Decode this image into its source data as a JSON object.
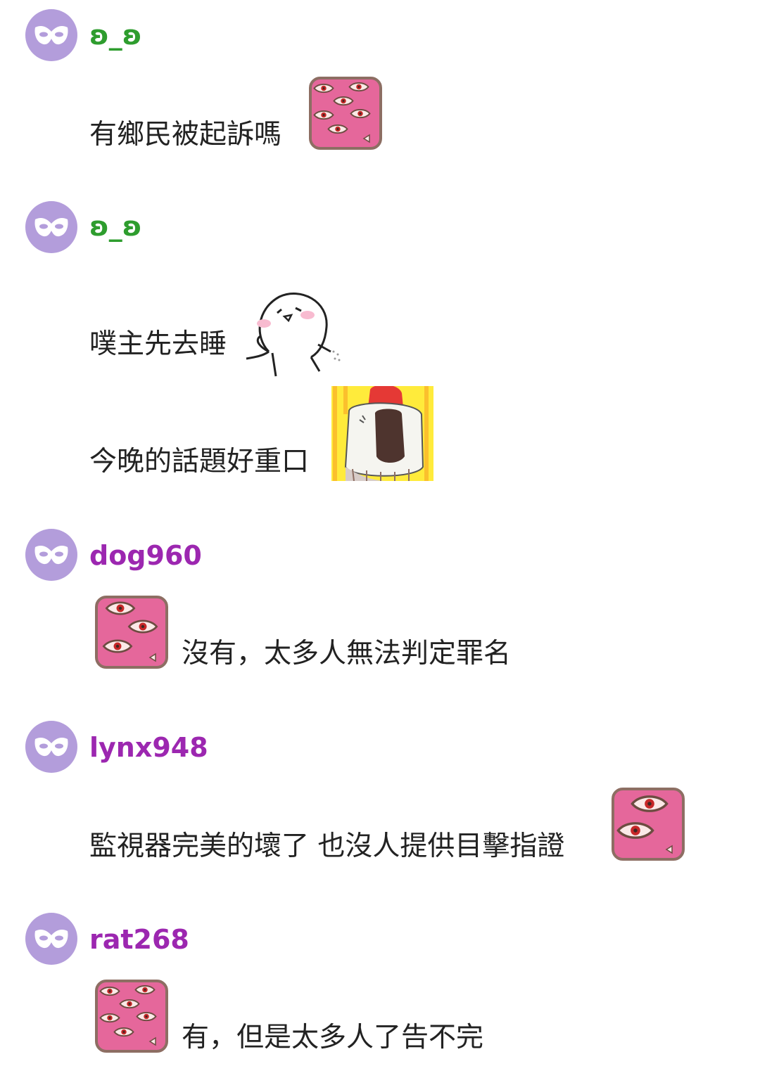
{
  "comments": [
    {
      "username": "ʚ_ʚ",
      "username_color": "#2e9d2e",
      "messages": [
        {
          "text": "有鄉民被起訴嗎",
          "sticker": "many-eyes-sticker"
        }
      ]
    },
    {
      "username": "ʚ_ʚ",
      "username_color": "#2e9d2e",
      "messages": [
        {
          "text": "噗主先去睡",
          "sticker": "white-blob-shrug-sticker"
        },
        {
          "text": "今晚的話題好重口",
          "sticker": "screaming-character-sticker"
        }
      ]
    },
    {
      "username": "dog960",
      "username_color": "#9c27b0",
      "messages": [
        {
          "text": "沒有，太多人無法判定罪名",
          "sticker": "three-eyes-sticker"
        }
      ]
    },
    {
      "username": "lynx948",
      "username_color": "#9c27b0",
      "messages": [
        {
          "text": "監視器完美的壞了 也沒人提供目擊指證",
          "sticker": "two-eyes-sticker"
        }
      ]
    },
    {
      "username": "rat268",
      "username_color": "#9c27b0",
      "messages": [
        {
          "text": "有，但是太多人了告不完",
          "sticker": "many-eyes-sticker"
        }
      ]
    }
  ],
  "avatar_icon": "mask-icon",
  "avatar_color": "#b39ddb"
}
